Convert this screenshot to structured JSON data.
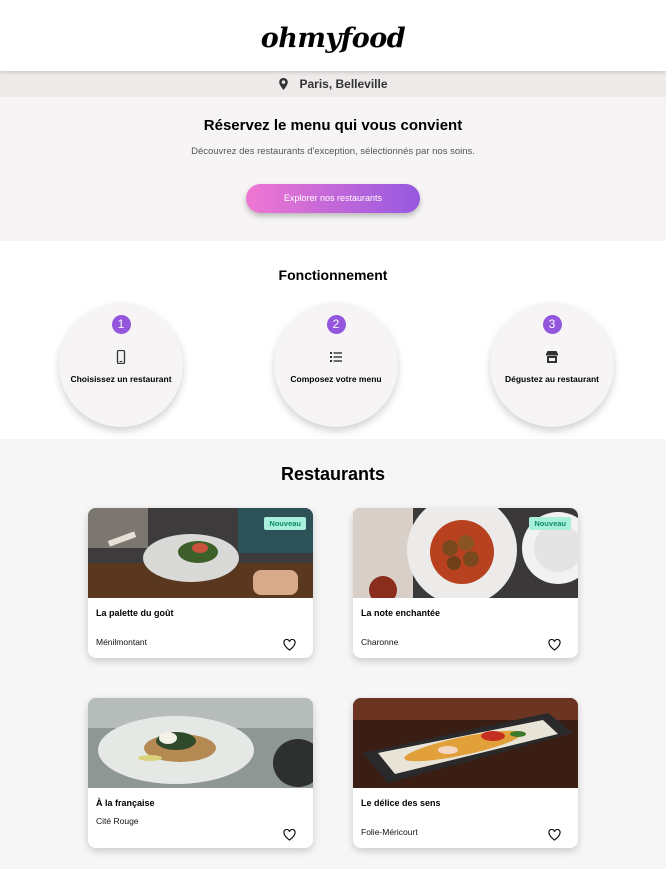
{
  "header": {
    "logo": "ohmyfood"
  },
  "location": {
    "icon": "map-pin-icon",
    "text": "Paris, Belleville"
  },
  "hero": {
    "title": "Réservez le menu qui vous convient",
    "subtitle": "Découvrez des restaurants d'exception, sélectionnés par nos soins.",
    "cta_label": "Explorer nos restaurants",
    "cta_gradient": [
      "#f077d2",
      "#9658e0"
    ]
  },
  "how_it_works": {
    "title": "Fonctionnement",
    "steps": [
      {
        "number": "1",
        "icon": "smartphone-icon",
        "label": "Choisissez un restaurant"
      },
      {
        "number": "2",
        "icon": "list-icon",
        "label": "Composez votre menu"
      },
      {
        "number": "3",
        "icon": "store-icon",
        "label": "Dégustez au restaurant"
      }
    ],
    "accent": "#9356dc"
  },
  "restaurants": {
    "title": "Restaurants",
    "items": [
      {
        "name": "La palette du goût",
        "area": "Ménilmontant",
        "badge": "Nouveau"
      },
      {
        "name": "La note enchantée",
        "area": "Charonne",
        "badge": "Nouveau"
      },
      {
        "name": "À la française",
        "area": "Cité Rouge",
        "badge": ""
      },
      {
        "name": "Le délice des sens",
        "area": "Folie-Méricourt",
        "badge": ""
      }
    ],
    "badge_color": "#a8f0dc"
  }
}
